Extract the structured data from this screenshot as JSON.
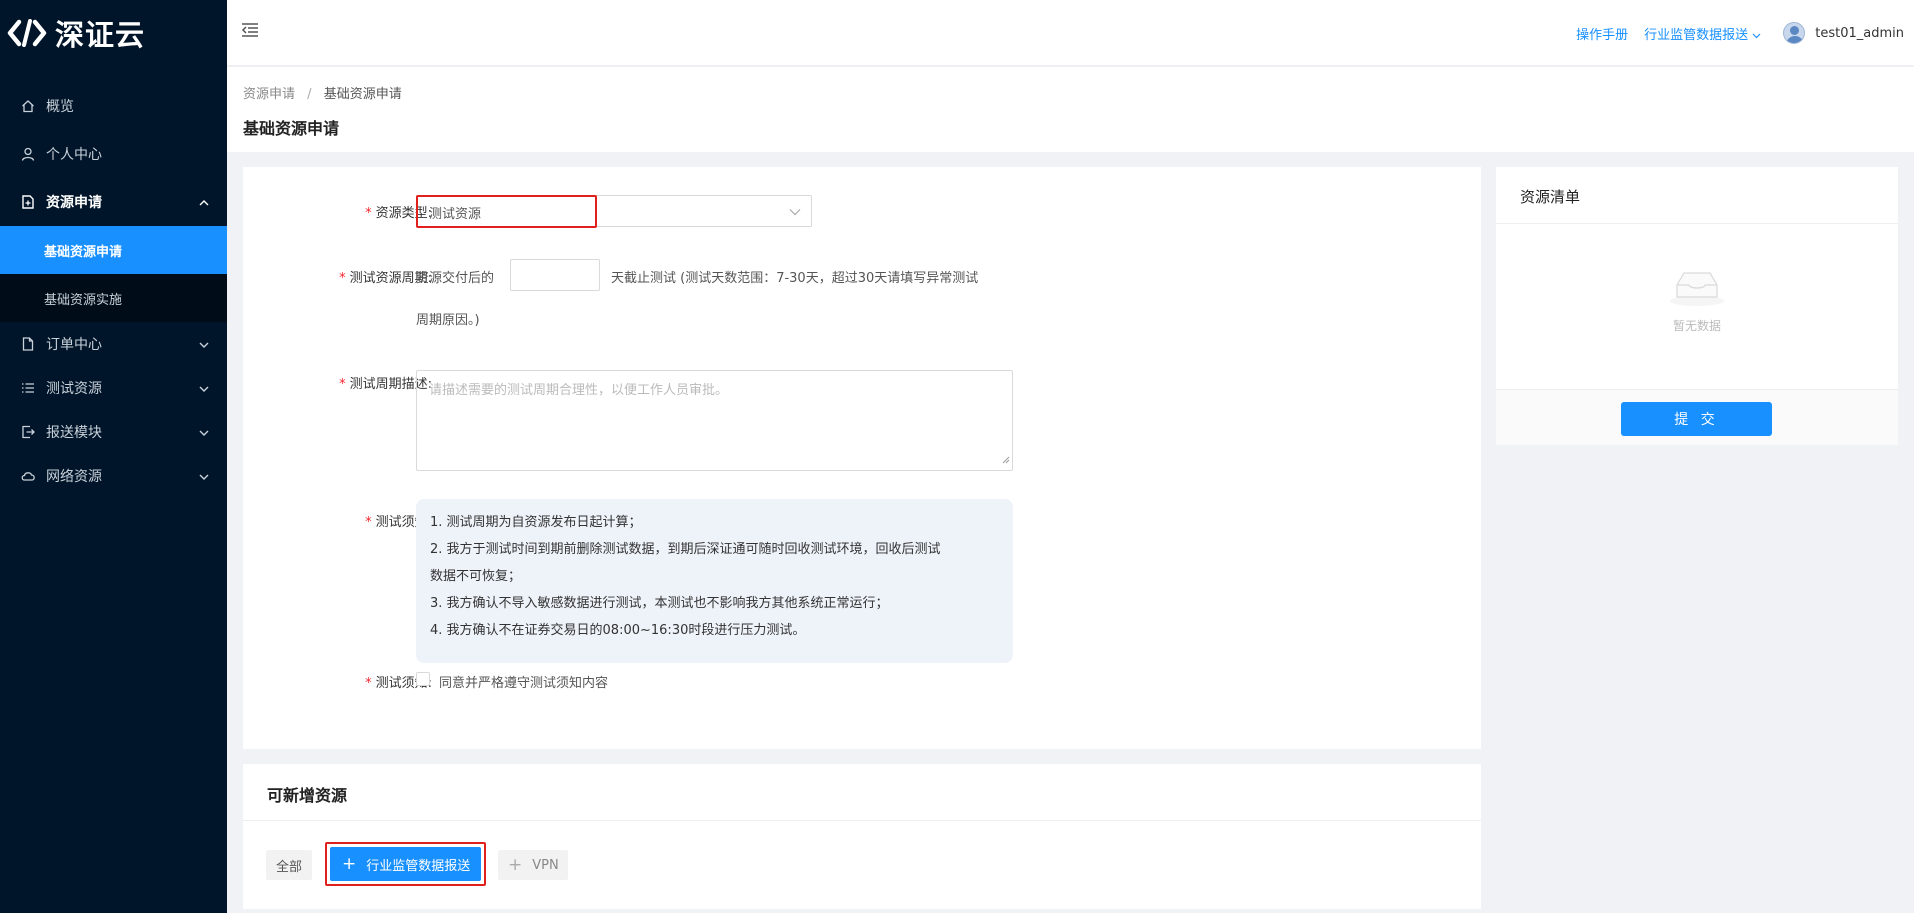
{
  "app": {
    "logo_text": "深证云"
  },
  "sidebar": {
    "items": [
      {
        "label": "概览",
        "icon": "home-icon"
      },
      {
        "label": "个人中心",
        "icon": "user-icon"
      },
      {
        "label": "资源申请",
        "icon": "file-icon"
      },
      {
        "label": "订单中心",
        "icon": "document-icon"
      },
      {
        "label": "测试资源",
        "icon": "list-icon"
      },
      {
        "label": "报送模块",
        "icon": "export-icon"
      },
      {
        "label": "网络资源",
        "icon": "cloud-icon"
      }
    ],
    "sub_items": [
      {
        "label": "基础资源申请",
        "active": true
      },
      {
        "label": "基础资源实施",
        "active": false
      }
    ]
  },
  "topbar": {
    "manual_link": "操作手册",
    "report_menu": "行业监管数据报送",
    "username": "test01_admin"
  },
  "breadcrumb": {
    "parent": "资源申请",
    "separator": "/",
    "current": "基础资源申请"
  },
  "page_title": "基础资源申请",
  "form": {
    "resource_type_label": "资源类型:",
    "resource_type_value": "测试资源",
    "period_label": "测试资源周期:",
    "period_prefix": "资源交付后的",
    "period_value": "",
    "period_suffix_line1": "天截止测试 (测试天数范围：7-30天，超过30天请填写异常测试",
    "period_suffix_line2": "周期原因。)",
    "desc_label": "测试周期描述:",
    "desc_placeholder": "请描述需要的测试周期合理性，以便工作人员审批。",
    "notice_label": "测试须知:",
    "notice_lines": [
      "1. 测试周期为自资源发布日起计算；",
      "2. 我方于测试时间到期前删除测试数据，到期后深证通可随时回收测试环境，回收后测试",
      "数据不可恢复；",
      "3. 我方确认不导入敏感数据进行测试，本测试也不影响我方其他系统正常运行；",
      "4. 我方确认不在证券交易日的08:00~16:30时段进行压力测试。"
    ],
    "agree_label": "测试须知:",
    "agree_text": "同意并严格遵守测试须知内容",
    "agree_checked": false
  },
  "resources": {
    "title": "可新增资源",
    "tags": [
      {
        "label": "全部"
      },
      {
        "label": "行业监管数据报送",
        "selected": true
      },
      {
        "label": "VPN",
        "selected": false
      }
    ]
  },
  "resource_list": {
    "title": "资源清单",
    "empty_text": "暂无数据",
    "submit_label": "提 交"
  },
  "colors": {
    "primary": "#1890ff",
    "sidebar_bg": "#001529",
    "highlight": "#e0201c",
    "required": "#f5222d"
  }
}
